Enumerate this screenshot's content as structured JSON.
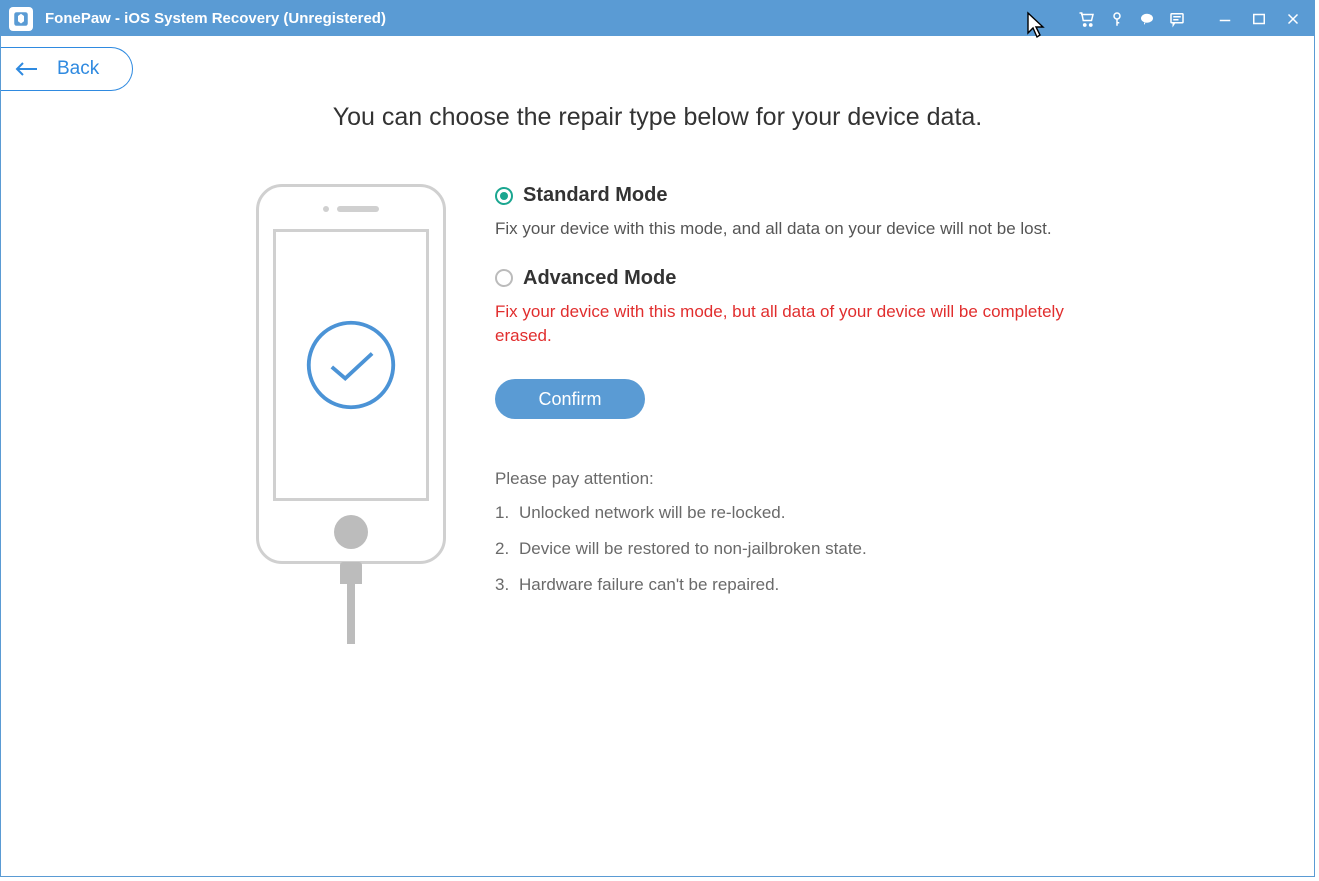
{
  "titlebar": {
    "title": "FonePaw - iOS System Recovery (Unregistered)"
  },
  "back": {
    "label": "Back"
  },
  "page": {
    "heading": "You can choose the repair type below for your device data."
  },
  "options": {
    "standard": {
      "title": "Standard Mode",
      "desc": "Fix your device with this mode, and all data on your device will not be lost.",
      "selected": true
    },
    "advanced": {
      "title": "Advanced Mode",
      "desc": "Fix your device with this mode, but all data of your device will be completely erased.",
      "selected": false
    }
  },
  "confirm_label": "Confirm",
  "attention": {
    "title": "Please pay attention:",
    "items": [
      "Unlocked network will be re-locked.",
      "Device will be restored to non-jailbroken state.",
      "Hardware failure can't be repaired."
    ]
  }
}
